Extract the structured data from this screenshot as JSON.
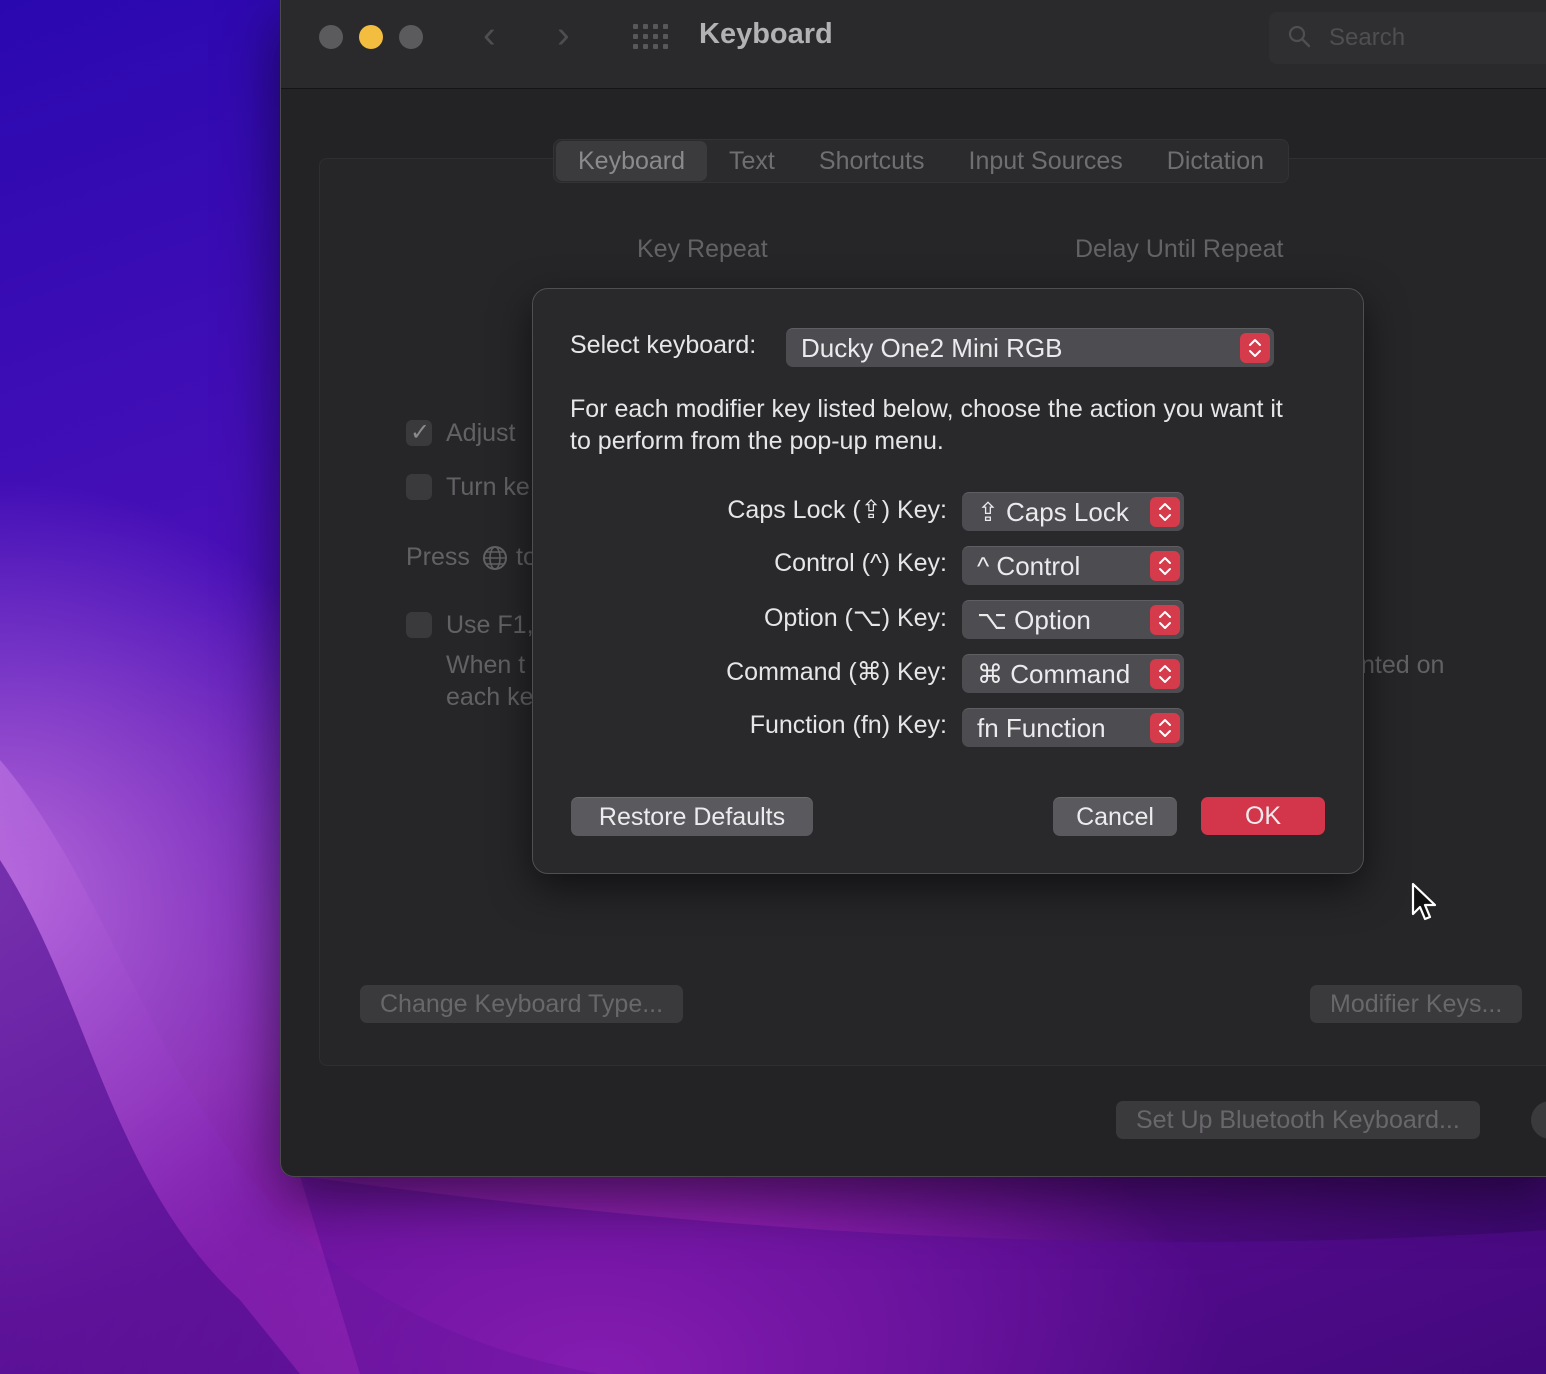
{
  "window": {
    "title": "Keyboard",
    "search_placeholder": "Search"
  },
  "tabs": [
    "Keyboard",
    "Text",
    "Shortcuts",
    "Input Sources",
    "Dictation"
  ],
  "background_panel": {
    "key_repeat_label": "Key Repeat",
    "delay_label": "Delay Until Repeat",
    "adjust_text": "Adjust",
    "turn_text": "Turn ke",
    "press_text": "Press",
    "press_suffix": "to",
    "use_text": "Use F1,",
    "when_text": "When t",
    "each_text": "each ke",
    "right_fragment": "nted on",
    "change_keyboard_button": "Change Keyboard Type...",
    "modifier_keys_button": "Modifier Keys...",
    "bluetooth_button": "Set Up Bluetooth Keyboard..."
  },
  "dialog": {
    "select_keyboard_label": "Select keyboard:",
    "selected_keyboard": "Ducky One2 Mini RGB",
    "description": "For each modifier key listed below, choose the action you want it to perform from the pop-up menu.",
    "rows": [
      {
        "label": "Caps Lock (⇪) Key:",
        "value": "⇪ Caps Lock"
      },
      {
        "label": "Control (^) Key:",
        "value": "^ Control"
      },
      {
        "label": "Option (⌥) Key:",
        "value": "⌥ Option"
      },
      {
        "label": "Command (⌘) Key:",
        "value": "⌘ Command"
      },
      {
        "label": "Function (fn) Key:",
        "value": "fn Function"
      }
    ],
    "restore_button": "Restore Defaults",
    "cancel_button": "Cancel",
    "ok_button": "OK"
  },
  "colors": {
    "accent": "#d3364a",
    "minimize_light": "#f3bd3f"
  }
}
